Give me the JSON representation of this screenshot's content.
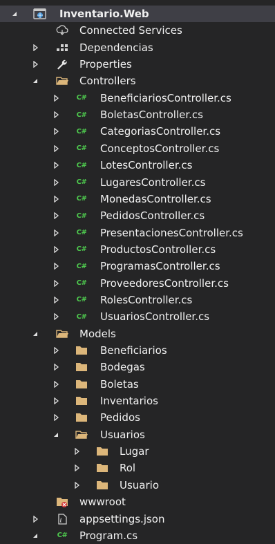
{
  "tree": [
    {
      "label": "Inventario.Web",
      "icon": "web-project-icon",
      "arrow": "expanded",
      "level": 0,
      "bold": true,
      "selected": true
    },
    {
      "label": "Connected Services",
      "icon": "connected-services-icon",
      "arrow": "none",
      "level": 1
    },
    {
      "label": "Dependencias",
      "icon": "dependencies-icon",
      "arrow": "collapsed",
      "level": 1
    },
    {
      "label": "Properties",
      "icon": "wrench-icon",
      "arrow": "collapsed",
      "level": 1
    },
    {
      "label": "Controllers",
      "icon": "folder-open-icon",
      "arrow": "expanded",
      "level": 1
    },
    {
      "label": "BeneficiariosController.cs",
      "icon": "csharp-file-icon",
      "arrow": "collapsed",
      "level": 2
    },
    {
      "label": "BoletasController.cs",
      "icon": "csharp-file-icon",
      "arrow": "collapsed",
      "level": 2
    },
    {
      "label": "CategoriasController.cs",
      "icon": "csharp-file-icon",
      "arrow": "collapsed",
      "level": 2
    },
    {
      "label": "ConceptosController.cs",
      "icon": "csharp-file-icon",
      "arrow": "collapsed",
      "level": 2
    },
    {
      "label": "LotesController.cs",
      "icon": "csharp-file-icon",
      "arrow": "collapsed",
      "level": 2
    },
    {
      "label": "LugaresController.cs",
      "icon": "csharp-file-icon",
      "arrow": "collapsed",
      "level": 2
    },
    {
      "label": "MonedasController.cs",
      "icon": "csharp-file-icon",
      "arrow": "collapsed",
      "level": 2
    },
    {
      "label": "PedidosController.cs",
      "icon": "csharp-file-icon",
      "arrow": "collapsed",
      "level": 2
    },
    {
      "label": "PresentacionesController.cs",
      "icon": "csharp-file-icon",
      "arrow": "collapsed",
      "level": 2
    },
    {
      "label": "ProductosController.cs",
      "icon": "csharp-file-icon",
      "arrow": "collapsed",
      "level": 2
    },
    {
      "label": "ProgramasController.cs",
      "icon": "csharp-file-icon",
      "arrow": "collapsed",
      "level": 2
    },
    {
      "label": "ProveedoresController.cs",
      "icon": "csharp-file-icon",
      "arrow": "collapsed",
      "level": 2
    },
    {
      "label": "RolesController.cs",
      "icon": "csharp-file-icon",
      "arrow": "collapsed",
      "level": 2
    },
    {
      "label": "UsuariosController.cs",
      "icon": "csharp-file-icon",
      "arrow": "collapsed",
      "level": 2
    },
    {
      "label": "Models",
      "icon": "folder-open-icon",
      "arrow": "expanded",
      "level": 1
    },
    {
      "label": "Beneficiarios",
      "icon": "folder-icon",
      "arrow": "collapsed",
      "level": 2
    },
    {
      "label": "Bodegas",
      "icon": "folder-icon",
      "arrow": "collapsed",
      "level": 2
    },
    {
      "label": "Boletas",
      "icon": "folder-icon",
      "arrow": "collapsed",
      "level": 2
    },
    {
      "label": "Inventarios",
      "icon": "folder-icon",
      "arrow": "collapsed",
      "level": 2
    },
    {
      "label": "Pedidos",
      "icon": "folder-icon",
      "arrow": "collapsed",
      "level": 2
    },
    {
      "label": "Usuarios",
      "icon": "folder-open-icon",
      "arrow": "expanded",
      "level": 2
    },
    {
      "label": "Lugar",
      "icon": "folder-icon",
      "arrow": "collapsed",
      "level": 3
    },
    {
      "label": "Rol",
      "icon": "folder-icon",
      "arrow": "collapsed",
      "level": 3
    },
    {
      "label": "Usuario",
      "icon": "folder-icon",
      "arrow": "collapsed",
      "level": 3
    },
    {
      "label": "wwwroot",
      "icon": "wwwroot-icon",
      "arrow": "none",
      "level": 1
    },
    {
      "label": "appsettings.json",
      "icon": "json-file-icon",
      "arrow": "collapsed",
      "level": 1
    },
    {
      "label": "Program.cs",
      "icon": "csharp-file-icon",
      "arrow": "expanded",
      "level": 1
    }
  ],
  "csharp_glyph": "C#",
  "colors": {
    "background": "#252526",
    "selected_row": "#3f3f46",
    "text": "#f1f1f1",
    "folder": "#dcb67a",
    "csharp": "#4ec94e",
    "web_icon": "#3c8fd6"
  }
}
